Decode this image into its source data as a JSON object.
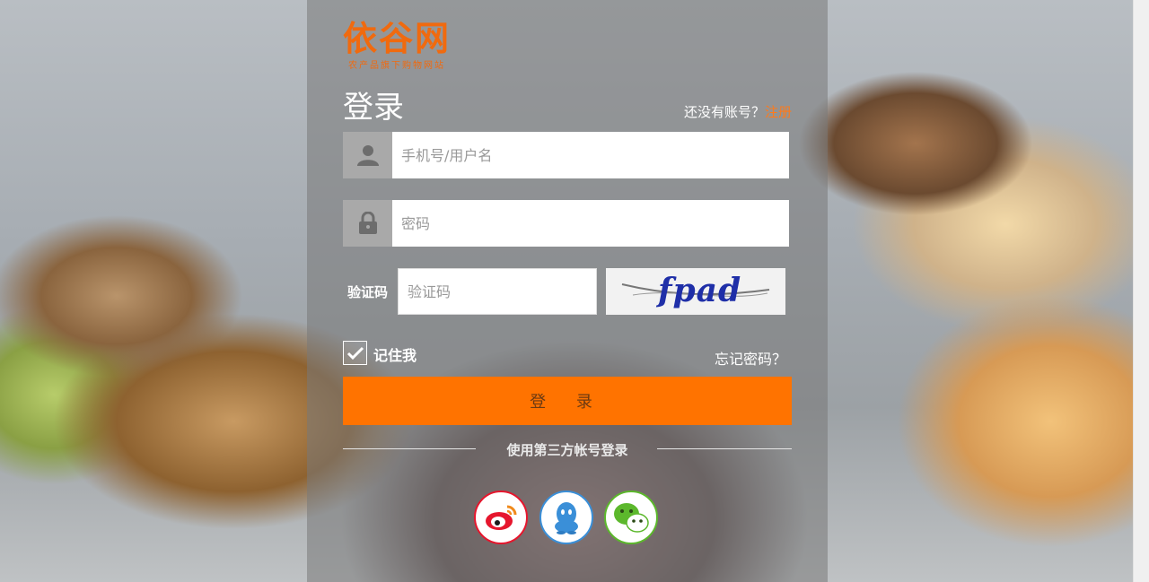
{
  "brand": {
    "logo_text": "依谷网",
    "tagline": "农产品旗下购物网站",
    "color": "#f06a0f"
  },
  "login": {
    "title": "登录",
    "no_account_text": "还没有账号？",
    "register_link": "注册",
    "username_placeholder": "手机号/用户名",
    "password_placeholder": "密码",
    "captcha_label": "验证码",
    "captcha_placeholder": "验证码",
    "captcha_text": "fpad",
    "remember_label": "记住我",
    "remember_checked": true,
    "forgot_link": "忘记密码？",
    "submit_label": "登 录",
    "accent_color": "#ff7300"
  },
  "third_party": {
    "heading": "使用第三方帐号登录",
    "providers": [
      {
        "name": "weibo",
        "icon": "weibo-icon",
        "color": "#e6162d"
      },
      {
        "name": "qq",
        "icon": "qq-icon",
        "color": "#3a8fd8"
      },
      {
        "name": "wechat",
        "icon": "wechat-icon",
        "color": "#5cb82c"
      }
    ]
  }
}
